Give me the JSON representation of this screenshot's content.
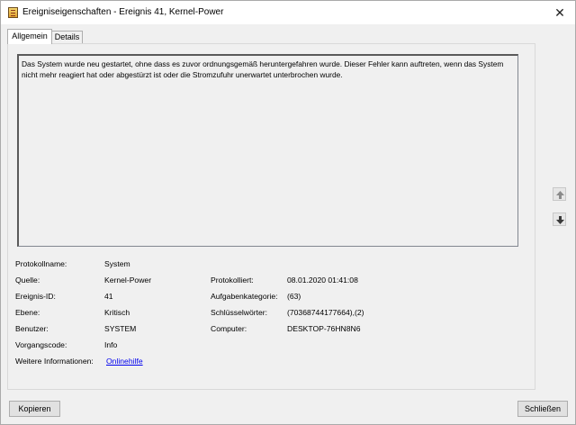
{
  "window": {
    "title": "Ereigniseigenschaften - Ereignis 41, Kernel-Power",
    "close_glyph": "✕"
  },
  "tabs": [
    {
      "label": "Allgemein",
      "selected": true
    },
    {
      "label": "Details",
      "selected": false
    }
  ],
  "description": "Das System wurde neu gestartet, ohne dass es zuvor ordnungsgemäß heruntergefahren wurde. Dieser Fehler kann auftreten, wenn das System nicht mehr reagiert hat oder abgestürzt ist oder die Stromzufuhr unerwartet unterbrochen wurde.",
  "fields": {
    "protokollname": {
      "label": "Protokollname:",
      "value": "System"
    },
    "quelle": {
      "label": "Quelle:",
      "value": "Kernel-Power"
    },
    "protokolliert": {
      "label": "Protokolliert:",
      "value": "08.01.2020 01:41:08"
    },
    "ereignis_id": {
      "label": "Ereignis-ID:",
      "value": "41"
    },
    "aufgabenkategorie": {
      "label": "Aufgabenkategorie:",
      "value": "(63)"
    },
    "ebene": {
      "label": "Ebene:",
      "value": "Kritisch"
    },
    "schluesselwoerter": {
      "label": "Schlüsselwörter:",
      "value": "(70368744177664),(2)"
    },
    "benutzer": {
      "label": "Benutzer:",
      "value": "SYSTEM"
    },
    "computer": {
      "label": "Computer:",
      "value": "DESKTOP-76HN8N6"
    },
    "vorgangscode": {
      "label": "Vorgangscode:",
      "value": "Info"
    },
    "weitere_informationen": {
      "label": "Weitere Informationen:",
      "link": "Onlinehilfe"
    }
  },
  "buttons": {
    "copy": "Kopieren",
    "close": "Schließen"
  },
  "icons": {
    "app": "event-log-icon",
    "up": "arrow-up-icon",
    "down": "arrow-down-icon"
  }
}
